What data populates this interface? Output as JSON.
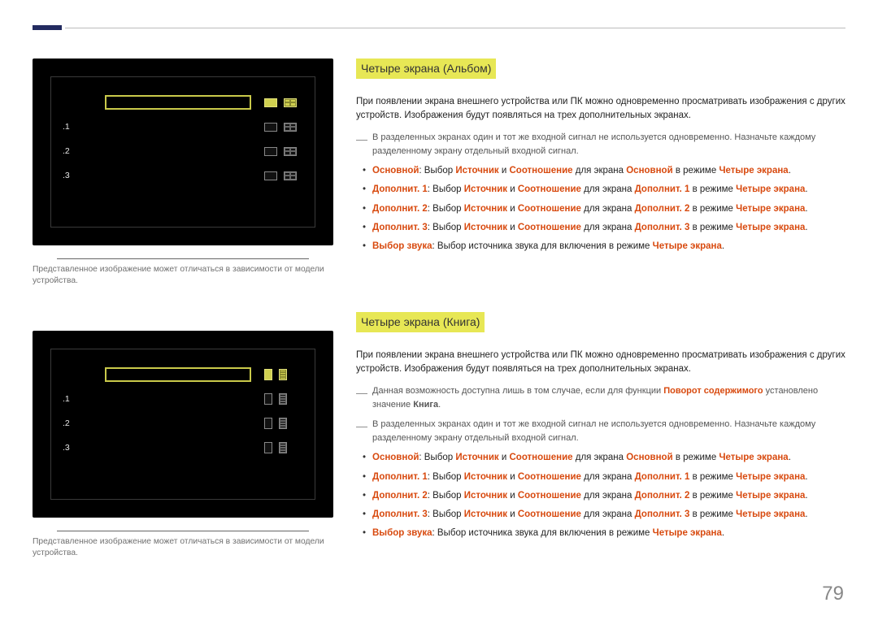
{
  "page_number": "79",
  "caption": "Представленное изображение может отличаться в зависимости от модели устройства.",
  "tv_items": [
    ".1",
    ".2",
    ".3"
  ],
  "section1": {
    "heading": "Четыре экрана (Альбом)",
    "intro": "При появлении экрана внешнего устройства или ПК можно одновременно просматривать изображения с других устройств. Изображения будут появляться на трех дополнительных экранах.",
    "note1": "В разделенных экранах один и тот же входной сигнал не используется одновременно. Назначьте каждому разделенному экрану отдельный входной сигнал.",
    "bullets": [
      {
        "t1": "Основной",
        "t2": ": Выбор ",
        "t3": "Источник",
        "t4": " и ",
        "t5": "Соотношение",
        "t6": " для экрана ",
        "t7": "Основной",
        "t8": " в режиме ",
        "t9": "Четыре экрана",
        "t10": "."
      },
      {
        "t1": "Дополнит. 1",
        "t2": ": Выбор ",
        "t3": "Источник",
        "t4": " и ",
        "t5": "Соотношение",
        "t6": " для экрана ",
        "t7": "Дополнит. 1",
        "t8": " в режиме ",
        "t9": "Четыре экрана",
        "t10": "."
      },
      {
        "t1": "Дополнит. 2",
        "t2": ": Выбор ",
        "t3": "Источник",
        "t4": " и ",
        "t5": "Соотношение",
        "t6": " для экрана ",
        "t7": "Дополнит. 2",
        "t8": " в режиме ",
        "t9": "Четыре экрана",
        "t10": "."
      },
      {
        "t1": "Дополнит. 3",
        "t2": ": Выбор ",
        "t3": "Источник",
        "t4": " и ",
        "t5": "Соотношение",
        "t6": " для экрана ",
        "t7": "Дополнит. 3",
        "t8": " в режиме ",
        "t9": "Четыре экрана",
        "t10": "."
      },
      {
        "t1": "Выбор звука",
        "t2": ": Выбор источника звука для включения в режиме ",
        "t3": "",
        "t4": "",
        "t5": "",
        "t6": "",
        "t7": "",
        "t8": "",
        "t9": "Четыре экрана",
        "t10": "."
      }
    ]
  },
  "section2": {
    "heading": "Четыре экрана (Книга)",
    "intro": "При появлении экрана внешнего устройства или ПК можно одновременно просматривать изображения с других устройств. Изображения будут появляться на трех дополнительных экранах.",
    "note1a": "Данная возможность доступна лишь в том случае, если для функции ",
    "note1b": "Поворот содержимого",
    "note1c": " установлено значение ",
    "note1d": "Книга",
    "note1e": ".",
    "note2": "В разделенных экранах один и тот же входной сигнал не используется одновременно. Назначьте каждому разделенному экрану отдельный входной сигнал.",
    "bullets": [
      {
        "t1": "Основной",
        "t2": ": Выбор ",
        "t3": "Источник",
        "t4": " и ",
        "t5": "Соотношение",
        "t6": " для экрана ",
        "t7": "Основной",
        "t8": " в режиме ",
        "t9": "Четыре экрана",
        "t10": "."
      },
      {
        "t1": "Дополнит. 1",
        "t2": ": Выбор ",
        "t3": "Источник",
        "t4": " и ",
        "t5": "Соотношение",
        "t6": " для экрана ",
        "t7": "Дополнит. 1",
        "t8": " в режиме ",
        "t9": "Четыре экрана",
        "t10": "."
      },
      {
        "t1": "Дополнит. 2",
        "t2": ": Выбор ",
        "t3": "Источник",
        "t4": " и ",
        "t5": "Соотношение",
        "t6": " для экрана ",
        "t7": "Дополнит. 2",
        "t8": " в режиме ",
        "t9": "Четыре экрана",
        "t10": "."
      },
      {
        "t1": "Дополнит. 3",
        "t2": ": Выбор ",
        "t3": "Источник",
        "t4": " и ",
        "t5": "Соотношение",
        "t6": " для экрана ",
        "t7": "Дополнит. 3",
        "t8": " в режиме ",
        "t9": "Четыре экрана",
        "t10": "."
      },
      {
        "t1": "Выбор звука",
        "t2": ": Выбор источника звука для включения в режиме ",
        "t3": "",
        "t4": "",
        "t5": "",
        "t6": "",
        "t7": "",
        "t8": "",
        "t9": "Четыре экрана",
        "t10": "."
      }
    ]
  }
}
